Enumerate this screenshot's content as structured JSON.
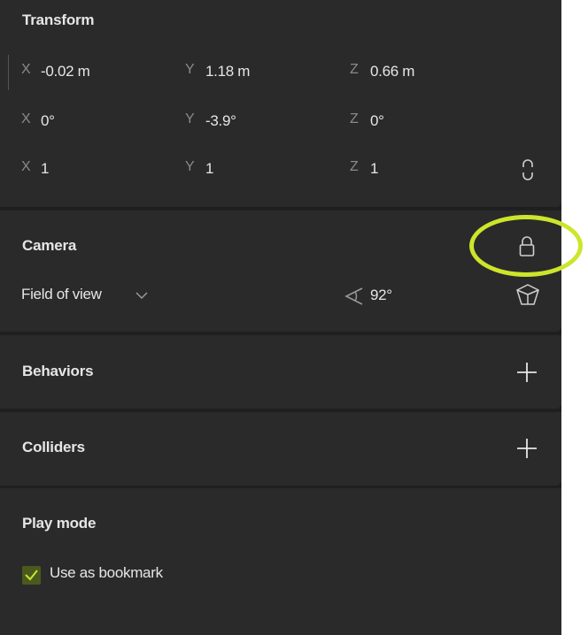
{
  "transform": {
    "title": "Transform",
    "position": {
      "x_label": "X",
      "x_value": "-0.02 m",
      "y_label": "Y",
      "y_value": "1.18 m",
      "z_label": "Z",
      "z_value": "0.66 m"
    },
    "rotation": {
      "x_label": "X",
      "x_value": "0°",
      "y_label": "Y",
      "y_value": "-3.9°",
      "z_label": "Z",
      "z_value": "0°"
    },
    "scale": {
      "x_label": "X",
      "x_value": "1",
      "y_label": "Y",
      "y_value": "1",
      "z_label": "Z",
      "z_value": "1"
    },
    "scale_link_icon": "link-toggle-icon"
  },
  "camera": {
    "title": "Camera",
    "lock_icon": "lock-icon",
    "fov_label": "Field of view",
    "fov_value": "92°",
    "fov_icon": "angle-icon",
    "view_icon": "cube-icon"
  },
  "behaviors": {
    "title": "Behaviors",
    "add_icon": "plus-icon"
  },
  "colliders": {
    "title": "Colliders",
    "add_icon": "plus-icon"
  },
  "play_mode": {
    "title": "Play mode",
    "bookmark_label": "Use as bookmark",
    "bookmark_checked": true
  },
  "colors": {
    "panel_bg": "#2a2a2a",
    "divider_bg": "#1f1f1f",
    "accent": "#cde52a",
    "checkbox_fill": "#4a5a1e"
  }
}
